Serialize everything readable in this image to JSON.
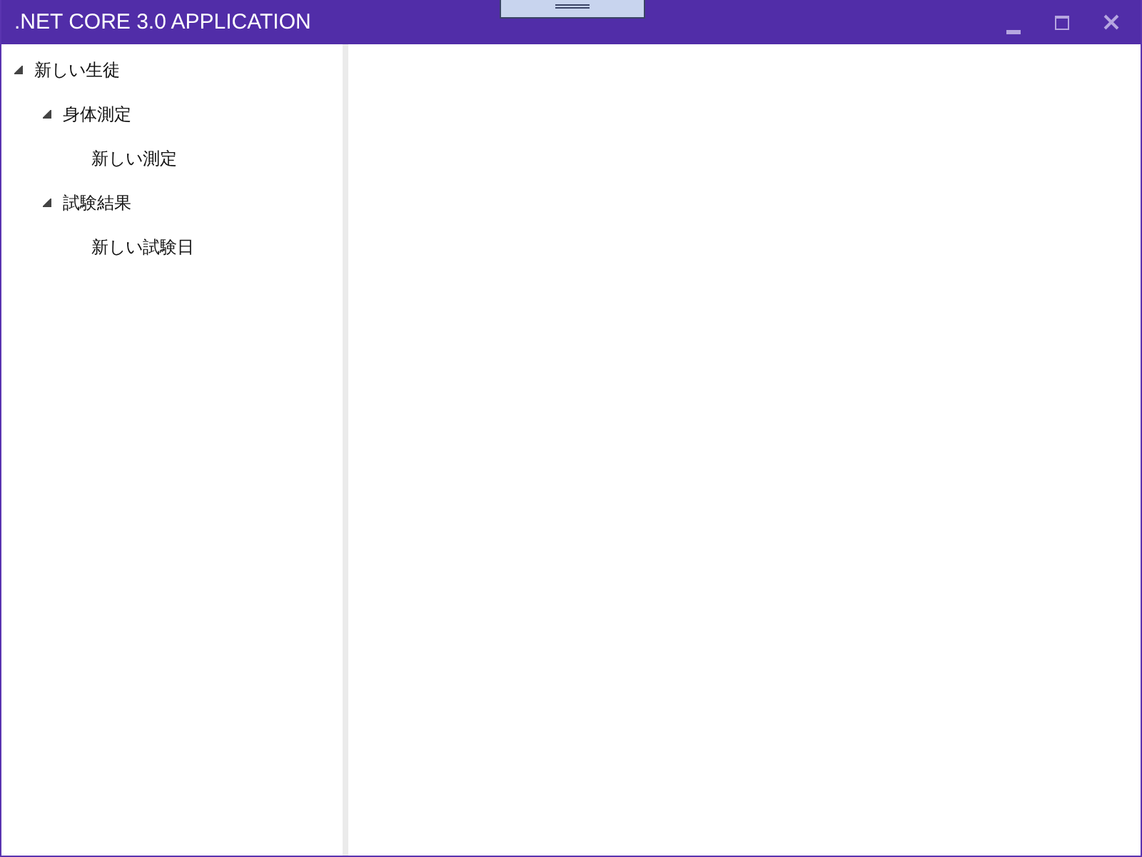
{
  "window": {
    "title": ".NET CORE 3.0 APPLICATION"
  },
  "tree": [
    {
      "label": "新しい生徒",
      "expanded": true,
      "children": [
        {
          "label": "身体測定",
          "expanded": true,
          "children": [
            {
              "label": "新しい測定"
            }
          ]
        },
        {
          "label": "試験結果",
          "expanded": true,
          "children": [
            {
              "label": "新しい試験日"
            }
          ]
        }
      ]
    }
  ]
}
